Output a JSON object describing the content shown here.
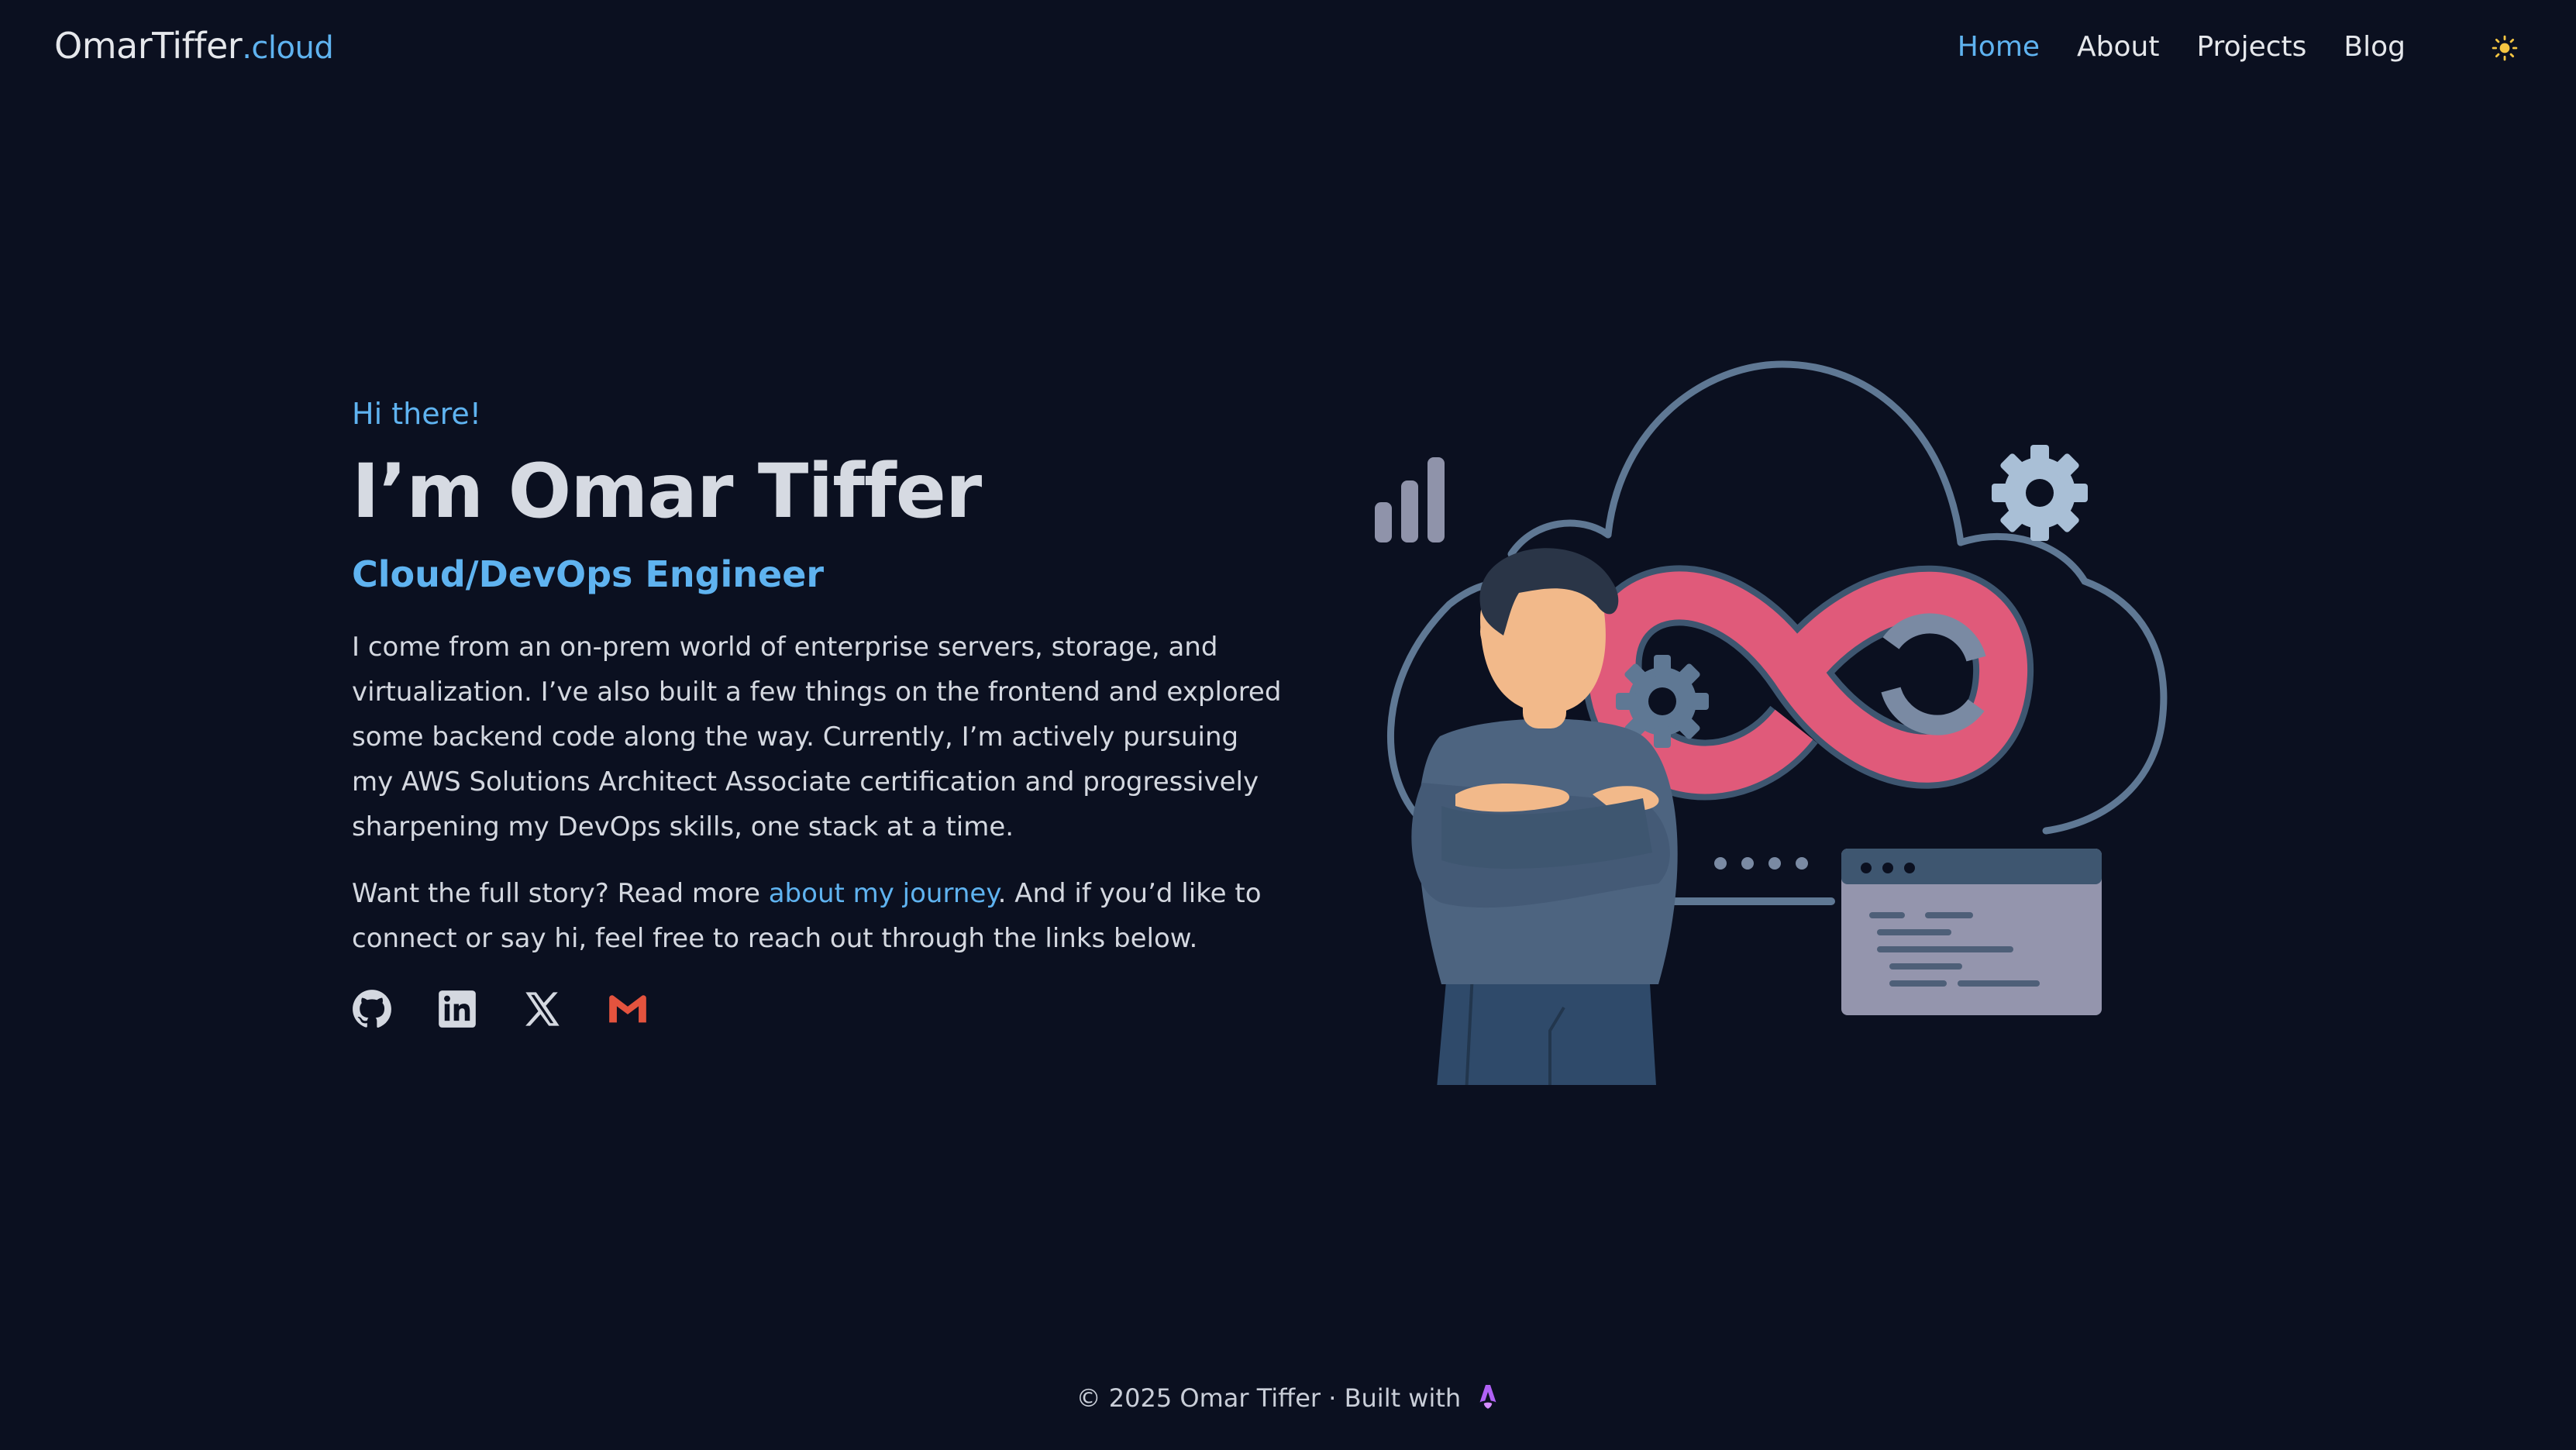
{
  "brand": {
    "name": "OmarTiffer",
    "tld": ".cloud"
  },
  "nav": {
    "items": [
      {
        "label": "Home",
        "active": true
      },
      {
        "label": "About",
        "active": false
      },
      {
        "label": "Projects",
        "active": false
      },
      {
        "label": "Blog",
        "active": false
      }
    ],
    "theme_toggle_icon": "sun-icon"
  },
  "hero": {
    "greeting": "Hi there!",
    "name": "I’m Omar Tiffer",
    "role": "Cloud/DevOps Engineer",
    "bio": "I come from an on-prem world of enterprise servers, storage, and virtualization. I’ve also built a few things on the frontend and explored some backend code along the way. Currently, I’m actively pursuing my AWS Solutions Architect Associate certification and progressively sharpening my DevOps skills, one stack at a time.",
    "cta_before": "Want the full story? Read more ",
    "cta_link": "about my journey",
    "cta_after": ". And if you’d like to connect or say hi, feel free to reach out through the links below.",
    "socials": [
      "github-icon",
      "linkedin-icon",
      "x-icon",
      "gmail-icon"
    ]
  },
  "footer": {
    "text": "© 2025 Omar Tiffer · Built with",
    "icon": "astro-icon"
  },
  "colors": {
    "background": "#0b1020",
    "accent": "#5fb3f0",
    "infinity": "#e05a7a"
  }
}
